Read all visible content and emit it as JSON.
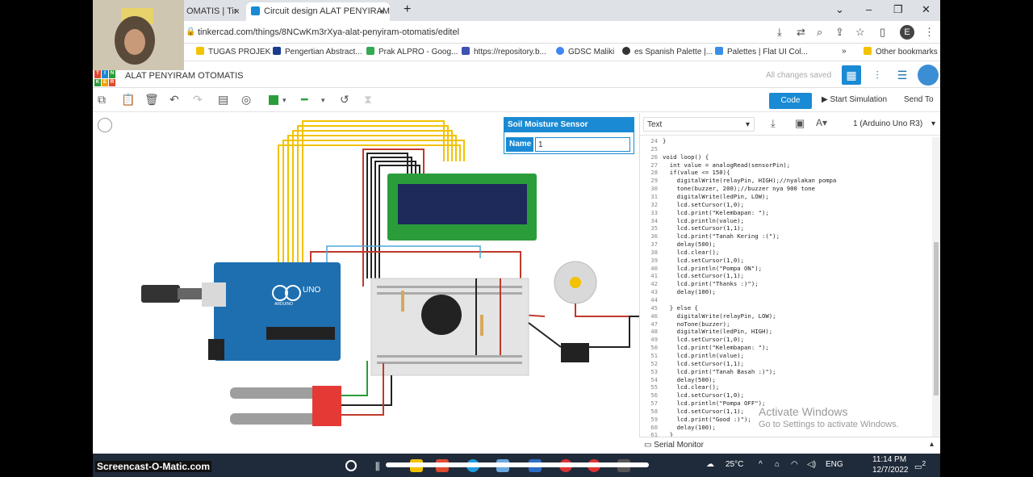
{
  "browser": {
    "tabs": [
      {
        "label": "OMATIS | Tir",
        "active": false
      },
      {
        "label": "Circuit design ALAT PENYIRAM O",
        "active": true
      }
    ],
    "url": "tinkercad.com/things/8NCwKm3rXya-alat-penyiram-otomatis/editel",
    "profile_initial": "E",
    "bookmarks": [
      {
        "label": "TUGAS PROJEK",
        "color": "#f2c200"
      },
      {
        "label": "Pengertian Abstract...",
        "color": "#1a3c8f"
      },
      {
        "label": "Prak ALPRO - Goog...",
        "color": "#34a853"
      },
      {
        "label": "https://repository.b...",
        "color": "#3f51b5"
      },
      {
        "label": "GDSC Maliki",
        "color": "#4285f4"
      },
      {
        "label": "es Spanish Palette |...",
        "color": "#333333"
      },
      {
        "label": "Palettes | Flat UI Col...",
        "color": "#3a8ee6"
      }
    ],
    "other_bookmarks": "Other bookmarks"
  },
  "tinkercad": {
    "logo": [
      "TIN",
      "KER",
      "CAD"
    ],
    "project_title": "ALAT PENYIRAM OTOMATIS",
    "saved_status": "All changes saved",
    "toolbar": {
      "code_label": "Code",
      "simulation_label": "Start Simulation",
      "send_label": "Send To"
    }
  },
  "inspector": {
    "title": "Soil Moisture Sensor",
    "name_label": "Name",
    "name_value": "1"
  },
  "code_panel": {
    "mode": "Text",
    "board": "1 (Arduino Uno R3)",
    "serial_monitor": "Serial Monitor",
    "lines": [
      {
        "n": "24",
        "t": "}"
      },
      {
        "n": "25",
        "t": ""
      },
      {
        "n": "26",
        "t": "void loop() {"
      },
      {
        "n": "27",
        "t": "  int value = analogRead(sensorPin);"
      },
      {
        "n": "28",
        "t": "  if(value <= 150){"
      },
      {
        "n": "29",
        "t": "    digitalWrite(relayPin, HIGH);//nyalakan pompa"
      },
      {
        "n": "30",
        "t": "    tone(buzzer, 200);//buzzer nya 900 tone"
      },
      {
        "n": "31",
        "t": "    digitalWrite(ledPin, LOW);"
      },
      {
        "n": "32",
        "t": "    lcd.setCursor(1,0);"
      },
      {
        "n": "33",
        "t": "    lcd.print(\"Kelembapan: \");"
      },
      {
        "n": "34",
        "t": "    lcd.println(value);"
      },
      {
        "n": "35",
        "t": "    lcd.setCursor(1,1);"
      },
      {
        "n": "36",
        "t": "    lcd.print(\"Tanah Kering :(\");"
      },
      {
        "n": "37",
        "t": "    delay(500);"
      },
      {
        "n": "38",
        "t": "    lcd.clear();"
      },
      {
        "n": "39",
        "t": "    lcd.setCursor(1,0);"
      },
      {
        "n": "40",
        "t": "    lcd.println(\"Pompa ON\");"
      },
      {
        "n": "41",
        "t": "    lcd.setCursor(1,1);"
      },
      {
        "n": "42",
        "t": "    lcd.print(\"Thanks :)\");"
      },
      {
        "n": "43",
        "t": "    delay(100);"
      },
      {
        "n": "44",
        "t": ""
      },
      {
        "n": "45",
        "t": "  } else {"
      },
      {
        "n": "46",
        "t": "    digitalWrite(relayPin, LOW);"
      },
      {
        "n": "47",
        "t": "    noTone(buzzer);"
      },
      {
        "n": "48",
        "t": "    digitalWrite(ledPin, HIGH);"
      },
      {
        "n": "49",
        "t": "    lcd.setCursor(1,0);"
      },
      {
        "n": "50",
        "t": "    lcd.print(\"Kelembapan: \");"
      },
      {
        "n": "51",
        "t": "    lcd.println(value);"
      },
      {
        "n": "52",
        "t": "    lcd.setCursor(1,1);"
      },
      {
        "n": "53",
        "t": "    lcd.print(\"Tanah Basah :)\");"
      },
      {
        "n": "54",
        "t": "    delay(500);"
      },
      {
        "n": "55",
        "t": "    lcd.clear();"
      },
      {
        "n": "56",
        "t": "    lcd.setCursor(1,0);"
      },
      {
        "n": "57",
        "t": "    lcd.println(\"Pompa OFF\");"
      },
      {
        "n": "58",
        "t": "    lcd.setCursor(1,1);"
      },
      {
        "n": "59",
        "t": "    lcd.print(\"Good :)\");"
      },
      {
        "n": "60",
        "t": "    delay(100);"
      },
      {
        "n": "61",
        "t": "  }"
      }
    ]
  },
  "arduino_label": "UNO",
  "arduino_brand": "ARDUINO",
  "windows": {
    "activate_title": "Activate Windows",
    "activate_sub": "Go to Settings to activate Windows.",
    "temp": "25°C",
    "lang": "ENG",
    "time": "11:14 PM",
    "date": "12/7/2022",
    "notif_count": "2"
  },
  "screencast_label": "Screencast-O-Matic.com",
  "colors": {
    "tinkercad_blue": "#1a8ad4",
    "taskbar": "#1f2a3a",
    "arduino_blue": "#1e6fb0",
    "lcd_green": "#2a9d3a",
    "wire_yellow": "#f2c200",
    "wire_red": "#c0392b"
  }
}
